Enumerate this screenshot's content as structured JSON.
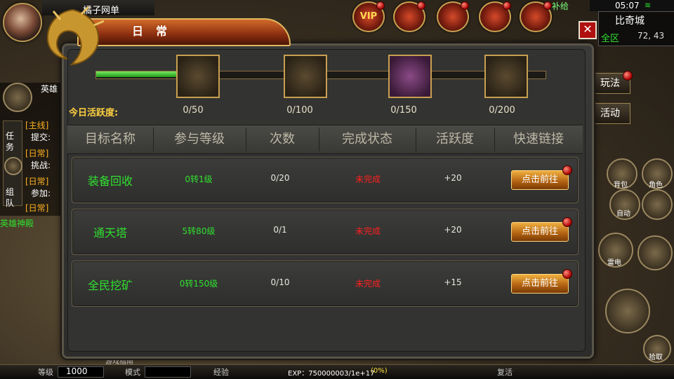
{
  "hud": {
    "player_label": "橘子网单",
    "bugei_label": "补给",
    "vip_label": "VIP",
    "time": "05:07",
    "map_name": "比奇城",
    "zone": "全区",
    "coords": "72, 43",
    "side_buttons": [
      "玩法",
      "活动"
    ],
    "hero_label": "英雄",
    "left_panel": [
      {
        "tag": "[主线]",
        "text": "提交:"
      },
      {
        "tag": "[日常]",
        "text": "挑战:"
      },
      {
        "tag": "[日常]",
        "text": "参加:"
      },
      {
        "tag": "[日常]",
        "text": ""
      }
    ],
    "left_tabs": [
      "任务",
      "组队"
    ],
    "left_green_text": "英雄神殿",
    "round_buttons": [
      "背包",
      "角色",
      "自动",
      "雷电",
      "拾取"
    ],
    "bottom": {
      "level_label": "等级",
      "level_value": "1000",
      "mode_label": "模式",
      "exp_label": "经验",
      "exp_text": "EXP：750000003/1e+17",
      "exp_percent": "(0%)",
      "revive_label": "复活",
      "guide_label": "游戏指南"
    }
  },
  "dialog": {
    "title": "日常",
    "activity_label": "今日活跃度:",
    "progress_fraction": 0.18,
    "chests": [
      {
        "count": "0/50",
        "color": "gold"
      },
      {
        "count": "0/100",
        "color": "gold"
      },
      {
        "count": "0/150",
        "color": "purple"
      },
      {
        "count": "0/200",
        "color": "gold"
      }
    ],
    "columns": [
      "目标名称",
      "参与等级",
      "次数",
      "完成状态",
      "活跃度",
      "快速链接"
    ],
    "rows": [
      {
        "name": "装备回收",
        "level": "0转1级",
        "count": "0/20",
        "status": "未完成",
        "points": "+20",
        "action": "点击前往"
      },
      {
        "name": "通天塔",
        "level": "5转80级",
        "count": "0/1",
        "status": "未完成",
        "points": "+20",
        "action": "点击前往"
      },
      {
        "name": "全民挖矿",
        "level": "0转150级",
        "count": "0/10",
        "status": "未完成",
        "points": "+15",
        "action": "点击前往"
      }
    ]
  }
}
